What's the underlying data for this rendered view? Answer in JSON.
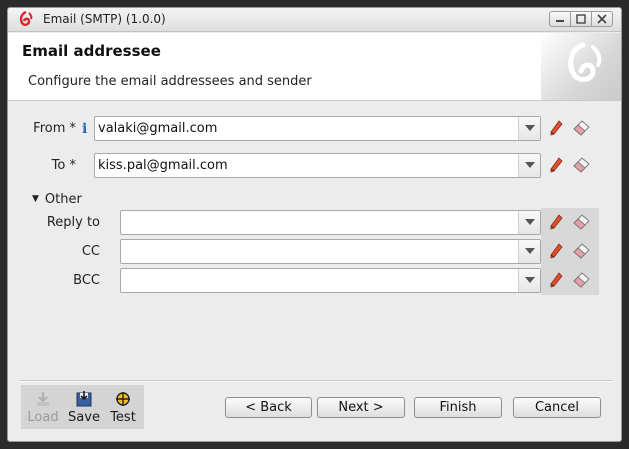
{
  "window": {
    "title": "Email (SMTP) (1.0.0)",
    "controls": [
      "minimize-icon",
      "maximize-icon",
      "close-icon"
    ]
  },
  "banner": {
    "title": "Email addressee",
    "subtitle": "Configure the email addressees and sender",
    "logo": "app-logo-icon"
  },
  "fields": {
    "from": {
      "label": "From *",
      "value": "valaki@gmail.com"
    },
    "to": {
      "label": "To *",
      "value": "kiss.pal@gmail.com"
    }
  },
  "other": {
    "toggle_label": "Other",
    "reply_to": {
      "label": "Reply to",
      "value": ""
    },
    "cc": {
      "label": "CC",
      "value": ""
    },
    "bcc": {
      "label": "BCC",
      "value": ""
    }
  },
  "toolbox": {
    "load": "Load",
    "save": "Save",
    "test": "Test"
  },
  "buttons": {
    "back": "< Back",
    "next": "Next >",
    "finish": "Finish",
    "cancel": "Cancel"
  },
  "colors": {
    "accent": "#d8262c",
    "info": "#2a63b8",
    "panel": "#ececec"
  }
}
